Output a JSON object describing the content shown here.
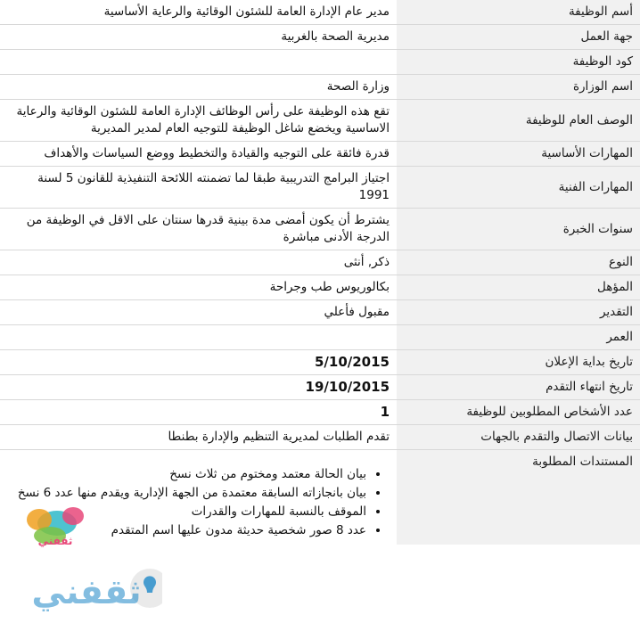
{
  "rows": [
    {
      "label": "أسم الوظيفة",
      "value": "مدير عام الإدارة العامة للشئون الوقائية والرعاية الأساسية",
      "bold": false
    },
    {
      "label": "جهة العمل",
      "value": "مديرية الصحة بالغربية",
      "bold": false
    },
    {
      "label": "كود الوظيفة",
      "value": "",
      "bold": false
    },
    {
      "label": "اسم الوزارة",
      "value": "وزارة الصحة",
      "bold": false
    },
    {
      "label": "الوصف العام للوظيفة",
      "value": "تقع هذه الوظيفة على رأس الوظائف الإدارة العامة للشئون الوقائية والرعاية الاساسية ويخضع شاغل الوظيفة للتوجيه العام لمدير المديرية",
      "bold": false
    },
    {
      "label": "المهارات الأساسية",
      "value": "قدرة فائقة على التوجيه والقيادة والتخطيط ووضع السياسات والأهداف",
      "bold": false
    },
    {
      "label": "المهارات الفنية",
      "value": "اجتياز البرامج التدريبية طبقا لما تضمنته اللائحة التنفيذية للقانون 5 لسنة 1991",
      "bold": false
    },
    {
      "label": "سنوات الخبرة",
      "value": "يشترط أن يكون أمضى مدة بينية قدرها سنتان على الاقل في الوظيفة من الدرجة الأدنى مباشرة",
      "bold": false
    },
    {
      "label": "النوع",
      "value": "ذكر, أنثى",
      "bold": false
    },
    {
      "label": "المؤهل",
      "value": "بكالوريوس طب وجراحة",
      "bold": false
    },
    {
      "label": "التقدير",
      "value": "مقبول فأعلي",
      "bold": false
    },
    {
      "label": "العمر",
      "value": "",
      "bold": false
    },
    {
      "label": "تاريخ بداية الإعلان",
      "value": "5/10/2015",
      "bold": true
    },
    {
      "label": "تاريخ انتهاء التقدم",
      "value": "19/10/2015",
      "bold": true
    },
    {
      "label": "عدد الأشخاص المطلوبين للوظيفة",
      "value": "1",
      "bold": true
    },
    {
      "label": "بيانات الاتصال والتقدم بالجهات",
      "value": "تقدم الطلبات لمديرية التنظيم والإدارة بطنطا",
      "bold": false
    }
  ],
  "documents": {
    "label": "المستندات المطلوبة",
    "items": [
      "بيان الحالة معتمد ومختوم من ثلاث نسخ",
      "بيان بانجازاته السابقة معتمدة من الجهة الإدارية ويقدم منها عدد 6 نسخ",
      "الموقف بالنسبة للمهارات والقدرات",
      "عدد 8 صور شخصية حديثة مدون عليها اسم المتقدم"
    ]
  },
  "watermark": {
    "text": "ثقفني",
    "colors": {
      "blue": "#1e88c8",
      "teal": "#2fb8c8",
      "orange": "#f0a020",
      "green": "#7cc242",
      "pink": "#e8487a"
    }
  }
}
